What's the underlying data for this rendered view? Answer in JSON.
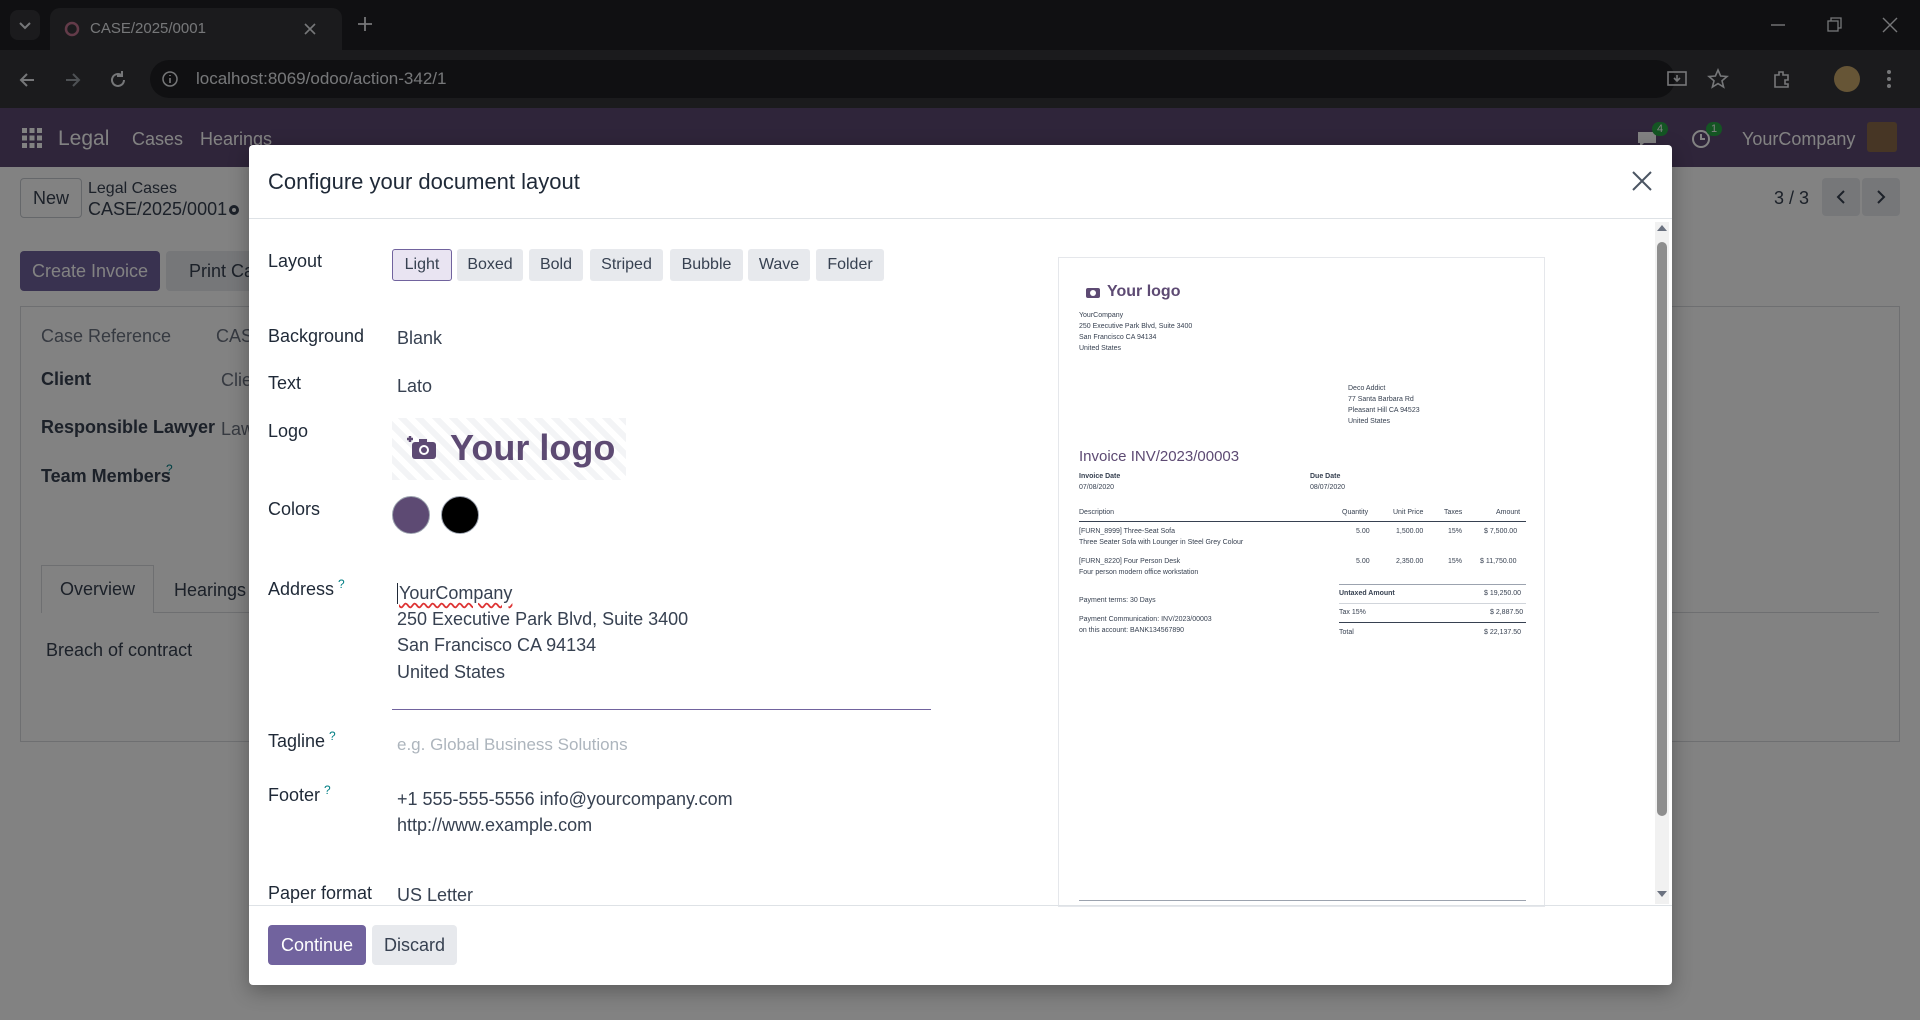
{
  "browser": {
    "tab_title": "CASE/2025/0001",
    "url": "localhost:8069/odoo/action-342/1"
  },
  "app": {
    "name": "Legal",
    "menu": [
      "Cases",
      "Hearings"
    ],
    "company": "YourCompany",
    "messages_count": "4",
    "activities_count": "1"
  },
  "control": {
    "new_label": "New",
    "breadcrumb_parent": "Legal Cases",
    "record_name": "CASE/2025/0001",
    "pager": "3 / 3",
    "create_invoice": "Create Invoice",
    "print_case": "Print Cas"
  },
  "form": {
    "case_reference_label": "Case Reference",
    "case_reference_value": "CAS",
    "client_label": "Client",
    "client_value": "Clie",
    "lawyer_label": "Responsible Lawyer",
    "lawyer_value": "Law",
    "team_label": "Team Members",
    "tabs": [
      "Overview",
      "Hearings"
    ],
    "overview_text": "Breach of contract"
  },
  "dialog": {
    "title": "Configure your document layout",
    "layout_label": "Layout",
    "layouts": [
      "Light",
      "Boxed",
      "Bold",
      "Striped",
      "Bubble",
      "Wave",
      "Folder"
    ],
    "active_layout": "Light",
    "background_label": "Background",
    "background_value": "Blank",
    "text_label": "Text",
    "text_value": "Lato",
    "logo_label": "Logo",
    "logo_text": "Your logo",
    "colors_label": "Colors",
    "colors": [
      "#5d4a73",
      "#000000"
    ],
    "address_label": "Address",
    "address_lines": [
      "YourCompany",
      "250 Executive Park Blvd, Suite 3400",
      "San Francisco CA 94134",
      "United States"
    ],
    "tagline_label": "Tagline",
    "tagline_placeholder": "e.g. Global Business Solutions",
    "footer_label": "Footer",
    "footer_lines": [
      "+1 555-555-5556 info@yourcompany.com",
      "http://www.example.com"
    ],
    "paper_label": "Paper format",
    "paper_value": "US Letter",
    "continue_label": "Continue",
    "discard_label": "Discard"
  },
  "preview": {
    "logo_text": "Your logo",
    "company_lines": [
      "YourCompany",
      "250 Executive Park Blvd, Suite 3400",
      "San Francisco CA 94134",
      "United States"
    ],
    "customer_lines": [
      "Deco Addict",
      "77 Santa Barbara Rd",
      "Pleasant Hill CA 94523",
      "United States"
    ],
    "invoice_title": "Invoice INV/2023/00003",
    "invoice_date_label": "Invoice Date",
    "invoice_date": "07/08/2020",
    "due_date_label": "Due Date",
    "due_date": "08/07/2020",
    "columns": [
      "Description",
      "Quantity",
      "Unit Price",
      "Taxes",
      "Amount"
    ],
    "lines": [
      {
        "desc": "[FURN_8999] Three-Seat Sofa",
        "desc2": "Three Seater Sofa with Lounger in Steel Grey Colour",
        "qty": "5.00",
        "price": "1,500.00",
        "tax": "15%",
        "amount": "$ 7,500.00"
      },
      {
        "desc": "[FURN_8220] Four Person Desk",
        "desc2": "Four person modern office workstation",
        "qty": "5.00",
        "price": "2,350.00",
        "tax": "15%",
        "amount": "$ 11,750.00"
      }
    ],
    "payment_terms": "Payment terms: 30 Days",
    "payment_comm": "Payment Communication: INV/2023/00003",
    "payment_account": "on this account: BANK134567890",
    "untaxed_label": "Untaxed Amount",
    "untaxed": "$ 19,250.00",
    "tax_label": "Tax 15%",
    "tax": "$ 2,887.50",
    "total_label": "Total",
    "total": "$ 22,137.50"
  }
}
